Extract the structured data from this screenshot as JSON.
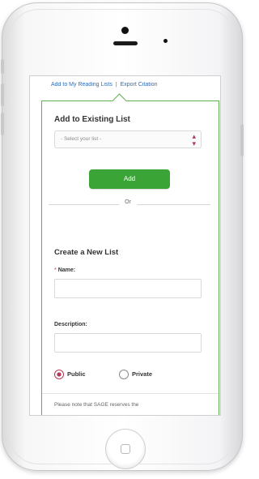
{
  "top_links": {
    "add_to_reading_lists": "Add to My Reading Lists",
    "separator": "|",
    "export_citation": "Export Citation"
  },
  "popup": {
    "existing_list_title": "Add to Existing List",
    "select_placeholder": "- Select your list -",
    "add_button": "Add",
    "or_label": "Or",
    "create_title": "Create a New List",
    "name_label": "Name:",
    "required_mark": "*",
    "description_label": "Description:",
    "radio_public": "Public",
    "radio_private": "Private",
    "selected_visibility": "Public",
    "note": "Please note that SAGE reserves the"
  },
  "icons": {
    "select_caret": "select-updown-icon",
    "home": "home-square-icon"
  },
  "colors": {
    "accent_green": "#3ba436",
    "border_green": "#5fb04a",
    "link_blue": "#2f6db5",
    "radio_accent": "#b13a58"
  }
}
